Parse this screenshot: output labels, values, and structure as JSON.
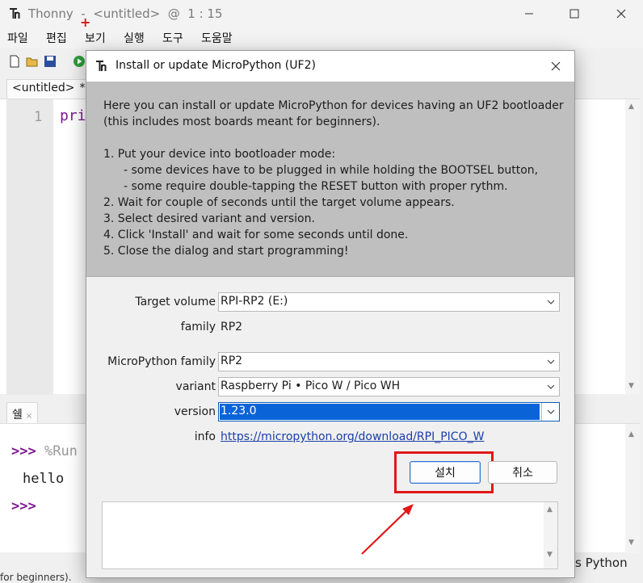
{
  "window": {
    "title": "Thonny  -  <untitled>  @  1 : 15"
  },
  "menu": {
    "items": [
      "파일",
      "편집",
      "보기",
      "실행",
      "도구",
      "도움말"
    ]
  },
  "toolbar": {
    "icons": [
      "new-file-icon",
      "open-file-icon",
      "save-icon",
      "run-icon"
    ]
  },
  "editor": {
    "tab_label": "<untitled>",
    "tab_close": "*",
    "line_numbers": [
      "1"
    ],
    "code_visible": "pri"
  },
  "shell": {
    "tab_label": "쉘",
    "tab_close": "×",
    "prompt": ">>>",
    "command_visible": "%Run",
    "output": "hello"
  },
  "statusbar": {
    "interpreter_visible": "s Python",
    "bottom_text": "for beginners)."
  },
  "dialog": {
    "title": "Install or update MicroPython (UF2)",
    "intro": [
      "Here you can install or update MicroPython for devices having an UF2 bootloader",
      "(this includes most boards meant for beginners).",
      "",
      "1. Put your device into bootloader mode:",
      "- some devices have to be plugged in while holding the BOOTSEL button,",
      "- some require double-tapping the RESET button with proper rythm.",
      "2. Wait for couple of seconds until the target volume appears.",
      "3. Select desired variant and version.",
      "4. Click 'Install' and wait for some seconds until done.",
      "5. Close the dialog and start programming!"
    ],
    "form": {
      "target_volume_label": "Target volume",
      "target_volume_value": "RPI-RP2 (E:)",
      "family_label": "family",
      "family_value": "RP2",
      "mp_family_label": "MicroPython family",
      "mp_family_value": "RP2",
      "variant_label": "variant",
      "variant_value": "Raspberry Pi • Pico W / Pico WH",
      "version_label": "version",
      "version_value": "1.23.0",
      "info_label": "info",
      "info_link": "https://micropython.org/download/RPI_PICO_W"
    },
    "buttons": {
      "install": "설치",
      "cancel": "취소"
    }
  },
  "colors": {
    "annotation_red": "#e01818",
    "selection_blue": "#0a64d8",
    "prompt_purple": "#7d1a8f"
  }
}
